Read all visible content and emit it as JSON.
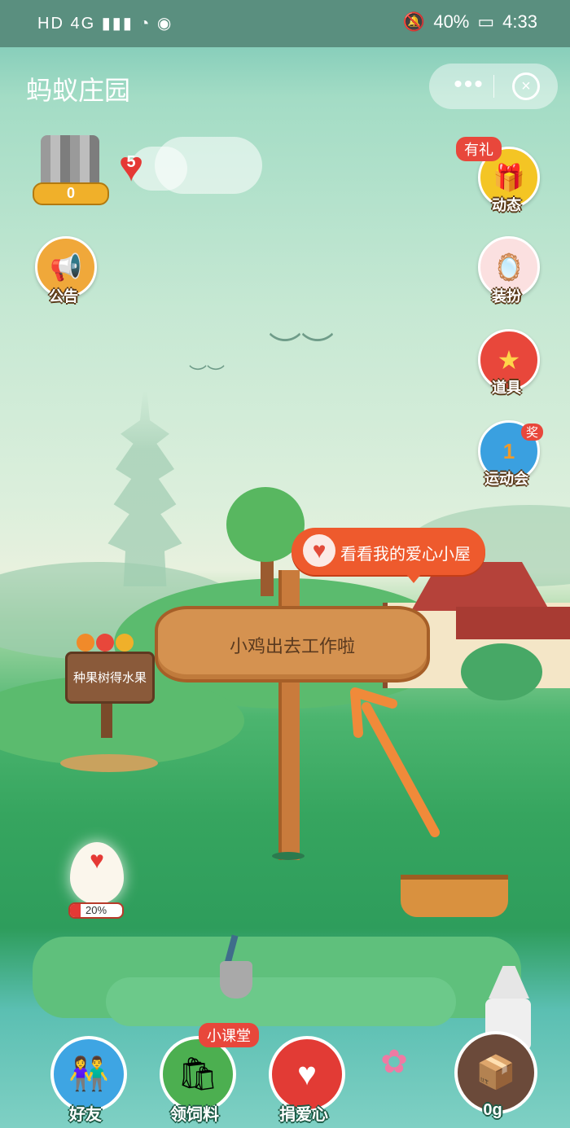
{
  "status_bar": {
    "left_icons": "HD 4G ▮▮▮ ◔ ◉",
    "battery": "40%",
    "time": "4:33"
  },
  "app": {
    "title": "蚂蚁庄园",
    "more_icon": "•••",
    "close_icon": "⊗"
  },
  "user": {
    "level": "0",
    "hearts": "5"
  },
  "side_buttons": {
    "announcement": {
      "label": "公告",
      "icon": "megaphone-icon"
    },
    "dynamics": {
      "label": "动态",
      "badge": "有礼",
      "icon": "gift-box-icon"
    },
    "dress_up": {
      "label": "装扮",
      "icon": "mirror-icon"
    },
    "props": {
      "label": "道具",
      "icon": "star-icon"
    },
    "sports": {
      "label": "运动会",
      "badge": "奖",
      "icon": "medal-icon",
      "medal_text": "1"
    }
  },
  "scene": {
    "love_house_bubble": "看看我的爱心小屋",
    "main_sign": "小鸡出去工作啦",
    "fruit_sign": "种果树得水果",
    "egg_progress": "20%",
    "egg_progress_value": 0.2
  },
  "bottom_nav": {
    "friends": {
      "label": "好友",
      "icon": "friends-icon"
    },
    "feed": {
      "label": "领饲料",
      "badge": "小课堂",
      "icon": "feed-bag-icon"
    },
    "donate": {
      "label": "捐爱心",
      "icon": "heart-icon"
    },
    "feed_amount": {
      "label": "0g",
      "icon": "feed-box-icon"
    }
  },
  "colors": {
    "accent_red": "#e8473b",
    "sign_wood": "#d59250",
    "grass": "#36a55f",
    "bubble": "#ee5a2d"
  }
}
